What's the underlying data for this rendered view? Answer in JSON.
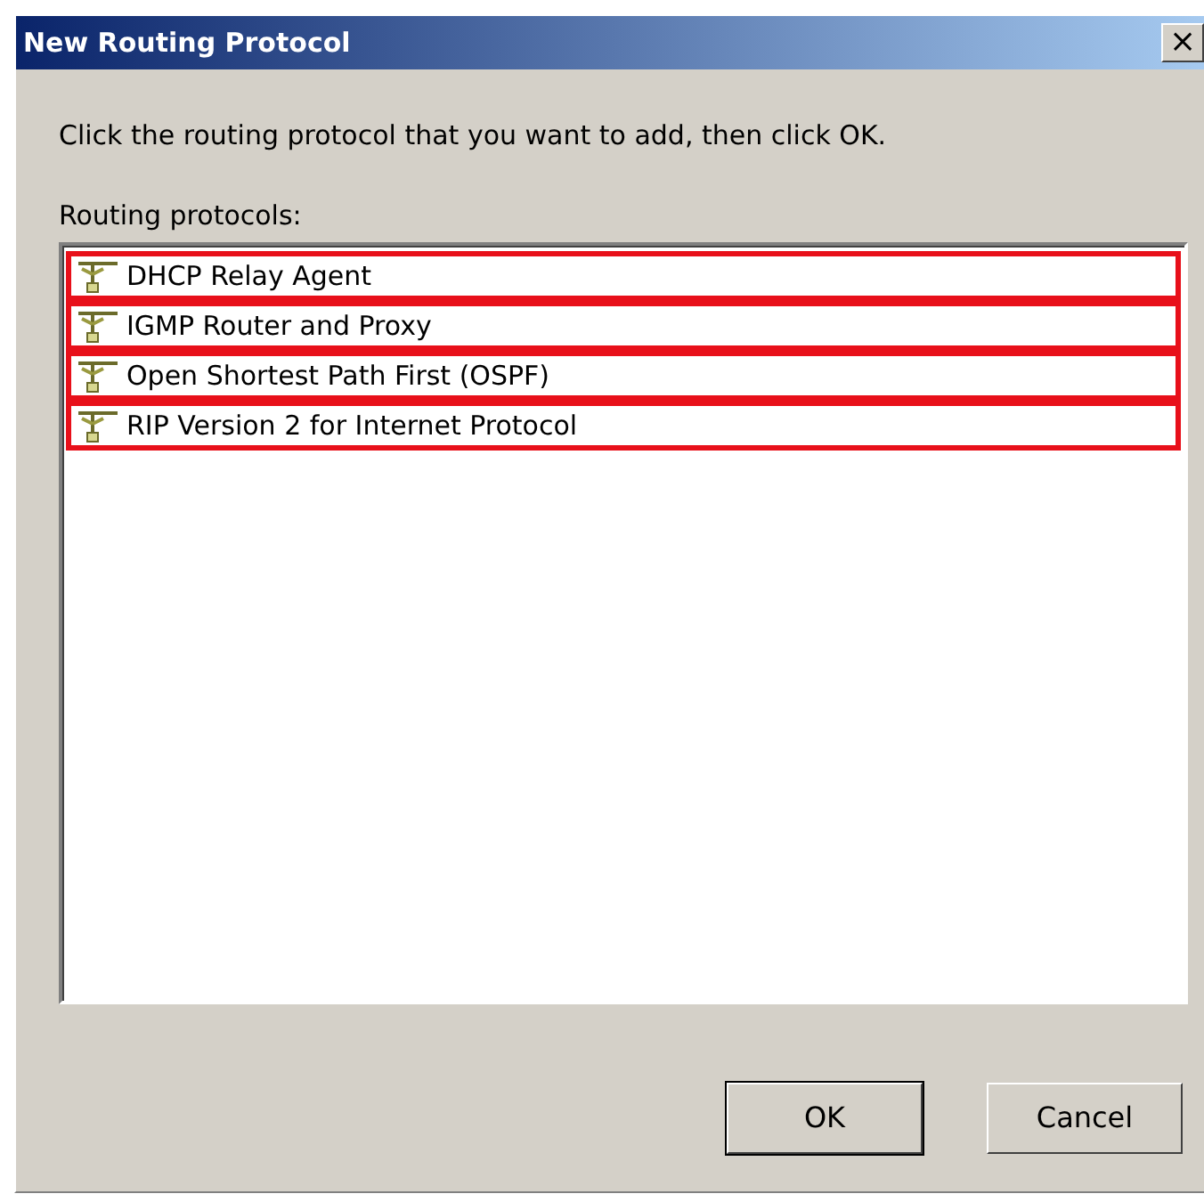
{
  "window": {
    "title": "New Routing Protocol",
    "close": "×"
  },
  "instruction": "Click the routing protocol that you want to add, then click OK.",
  "list_label": "Routing protocols:",
  "protocols": [
    {
      "name": "DHCP Relay Agent",
      "highlighted": true
    },
    {
      "name": "IGMP Router and Proxy",
      "highlighted": true
    },
    {
      "name": "Open Shortest Path First (OSPF)",
      "highlighted": true
    },
    {
      "name": "RIP Version 2 for Internet Protocol",
      "highlighted": true
    }
  ],
  "buttons": [
    {
      "label": "OK",
      "default": true
    },
    {
      "label": "Cancel",
      "default": false
    }
  ]
}
